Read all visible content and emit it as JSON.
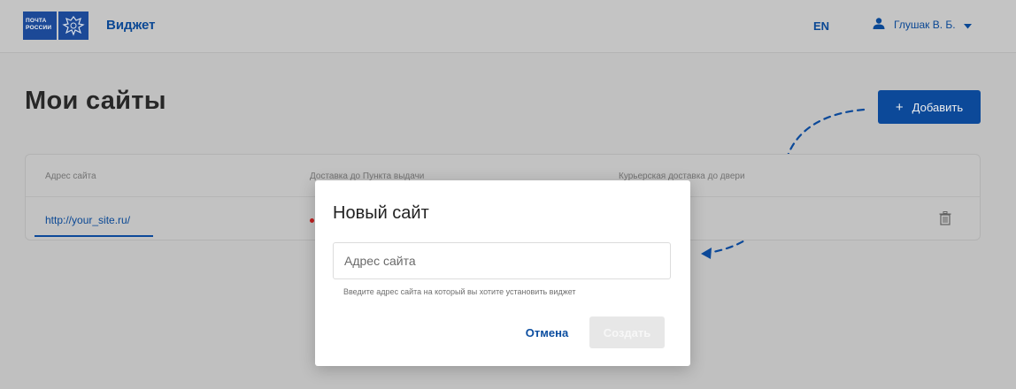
{
  "header": {
    "logo_text_line1": "ПОЧТА",
    "logo_text_line2": "РОССИИ",
    "app_title": "Виджет",
    "lang": "EN",
    "user_name": "Глушак В. Б."
  },
  "page": {
    "title": "Мои сайты",
    "add_button_label": "Добавить"
  },
  "table": {
    "columns": [
      "Адрес сайта",
      "Доставка до Пункта выдачи",
      "Курьерская доставка до двери"
    ],
    "rows": [
      {
        "site": "http://your_site.ru/"
      }
    ]
  },
  "dialog": {
    "title": "Новый сайт",
    "input_value": "",
    "input_placeholder": "Адрес сайта",
    "hint": "Введите адрес сайта на который вы хотите установить виджет",
    "cancel_label": "Отмена",
    "create_label": "Создать"
  },
  "colors": {
    "brand_blue": "#0d4fa5",
    "status_red": "#d02424"
  },
  "icons": [
    "user-icon",
    "chevron-down-icon",
    "plus-icon",
    "trash-icon",
    "eagle-emblem-icon"
  ]
}
